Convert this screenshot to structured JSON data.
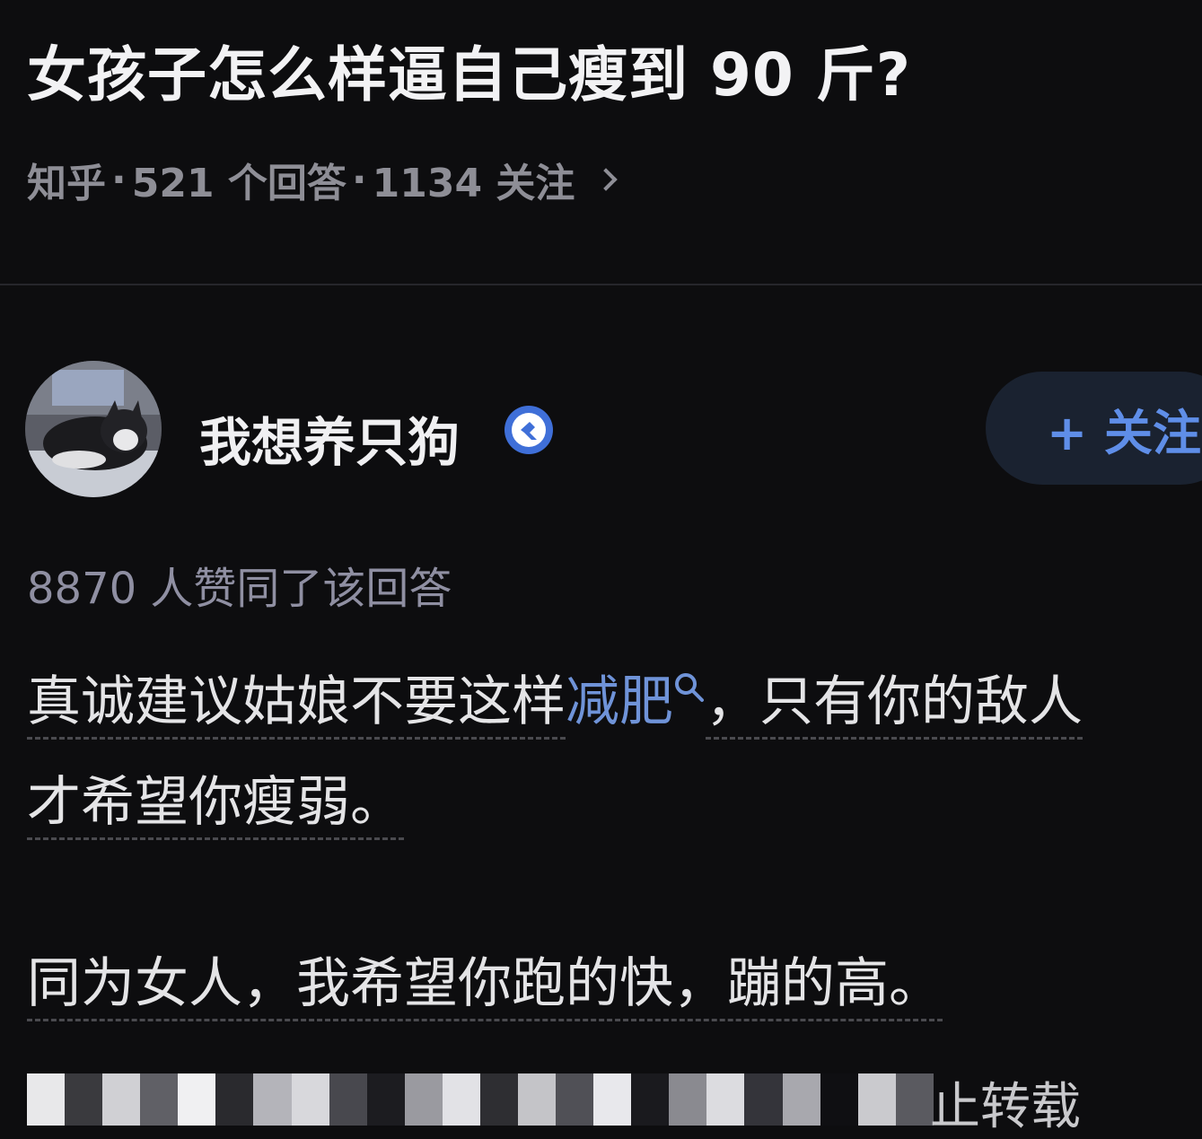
{
  "question": {
    "title": "女孩子怎么样逼自己瘦到 90 斤?",
    "source": "知乎",
    "answers": "521 个回答",
    "followers": "1134 关注"
  },
  "author": {
    "name": "我想养只狗",
    "badge_icon": "verified-badge-icon",
    "follow_label": "+ 关注"
  },
  "answer": {
    "vote_text": "8870 人赞同了该回答",
    "line1_before": "真诚建议姑娘不要这样",
    "keyword": "减肥",
    "line1_after": "，只有你的敌人",
    "line2": "才希望你瘦弱。",
    "line3": "同为女人，我希望你跑的快，蹦的高。"
  },
  "footer": {
    "notice": "止转载"
  },
  "colors": {
    "background": "#0d0d0f",
    "link": "#6f93d8",
    "follow": "#5f8ee8",
    "muted": "#8e8e96"
  }
}
